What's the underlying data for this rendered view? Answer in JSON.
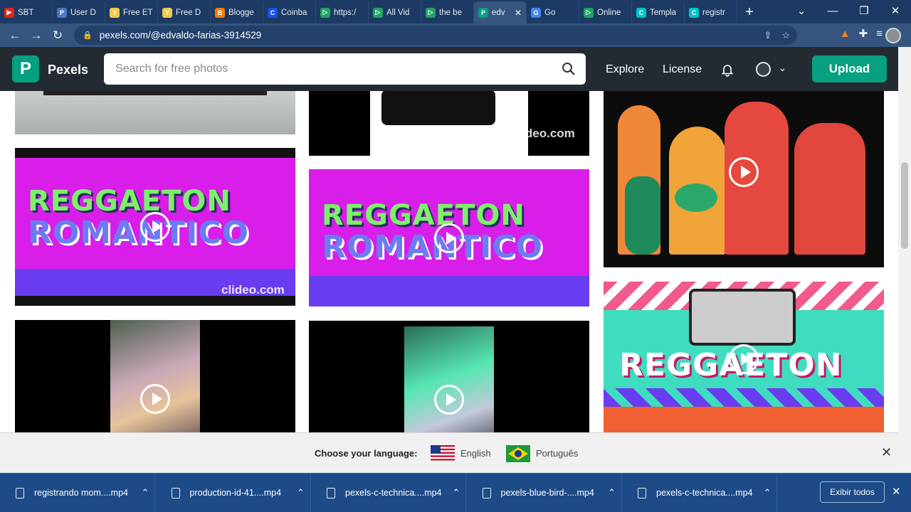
{
  "browser": {
    "tabs": [
      {
        "title": "SBT",
        "icon": "youtube-icon",
        "color": "#e62117",
        "mark": "▶"
      },
      {
        "title": "User D",
        "icon": "page-icon",
        "color": "#4a77c4",
        "mark": "P"
      },
      {
        "title": "Free ET",
        "icon": "yellow-page-icon",
        "color": "#f2c94c",
        "mark": "Y"
      },
      {
        "title": "Free D",
        "icon": "yellow-page-icon",
        "color": "#f2c94c",
        "mark": "Y"
      },
      {
        "title": "Blogge",
        "icon": "blogger-icon",
        "color": "#f57c00",
        "mark": "B"
      },
      {
        "title": "Coinba",
        "icon": "coinbase-icon",
        "color": "#1652f0",
        "mark": "C"
      },
      {
        "title": "https:/",
        "icon": "play-icon",
        "color": "#1fa463",
        "mark": "▷"
      },
      {
        "title": "All Vid",
        "icon": "play-icon",
        "color": "#1fa463",
        "mark": "▷"
      },
      {
        "title": "the be",
        "icon": "play-icon",
        "color": "#1fa463",
        "mark": "▷"
      },
      {
        "title": "edv",
        "icon": "pexels-icon",
        "color": "#05a081",
        "mark": "P"
      },
      {
        "title": "Go",
        "icon": "translate-icon",
        "color": "#4285f4",
        "mark": "G"
      },
      {
        "title": "Online",
        "icon": "play-icon",
        "color": "#1fa463",
        "mark": "▷"
      },
      {
        "title": "Templa",
        "icon": "canva-icon",
        "color": "#00c4cc",
        "mark": "C"
      },
      {
        "title": "registr",
        "icon": "canva-icon",
        "color": "#00c4cc",
        "mark": "C"
      }
    ],
    "active_tab": 9,
    "url": "pexels.com/@edvaldo-farias-3914529"
  },
  "pexels": {
    "brand": "Pexels",
    "logo_letter": "P",
    "search_placeholder": "Search for free photos",
    "nav": {
      "explore": "Explore",
      "license": "License"
    },
    "upload": "Upload"
  },
  "grid": {
    "watermark": "clideo.com",
    "reggaeton_line1": "REGGAETON",
    "reggaeton_line2": "ROMANTICO",
    "reggaeton_big": "REGGAETON"
  },
  "language_bar": {
    "prompt": "Choose your language:",
    "options": [
      {
        "label": "English",
        "flag": "us-flag-icon"
      },
      {
        "label": "Português",
        "flag": "brazil-flag-icon"
      }
    ]
  },
  "downloads": {
    "items": [
      "registrando mom....mp4",
      "production-id-41....mp4",
      "pexels-c-technica....mp4",
      "pexels-blue-bird-....mp4",
      "pexels-c-technica....mp4"
    ],
    "show_all": "Exibir todos"
  },
  "colors": {
    "pexels_green": "#05a081",
    "header_dark": "#232a31",
    "download_bar": "#1c4b87",
    "tab_strip": "#1c3a63"
  }
}
